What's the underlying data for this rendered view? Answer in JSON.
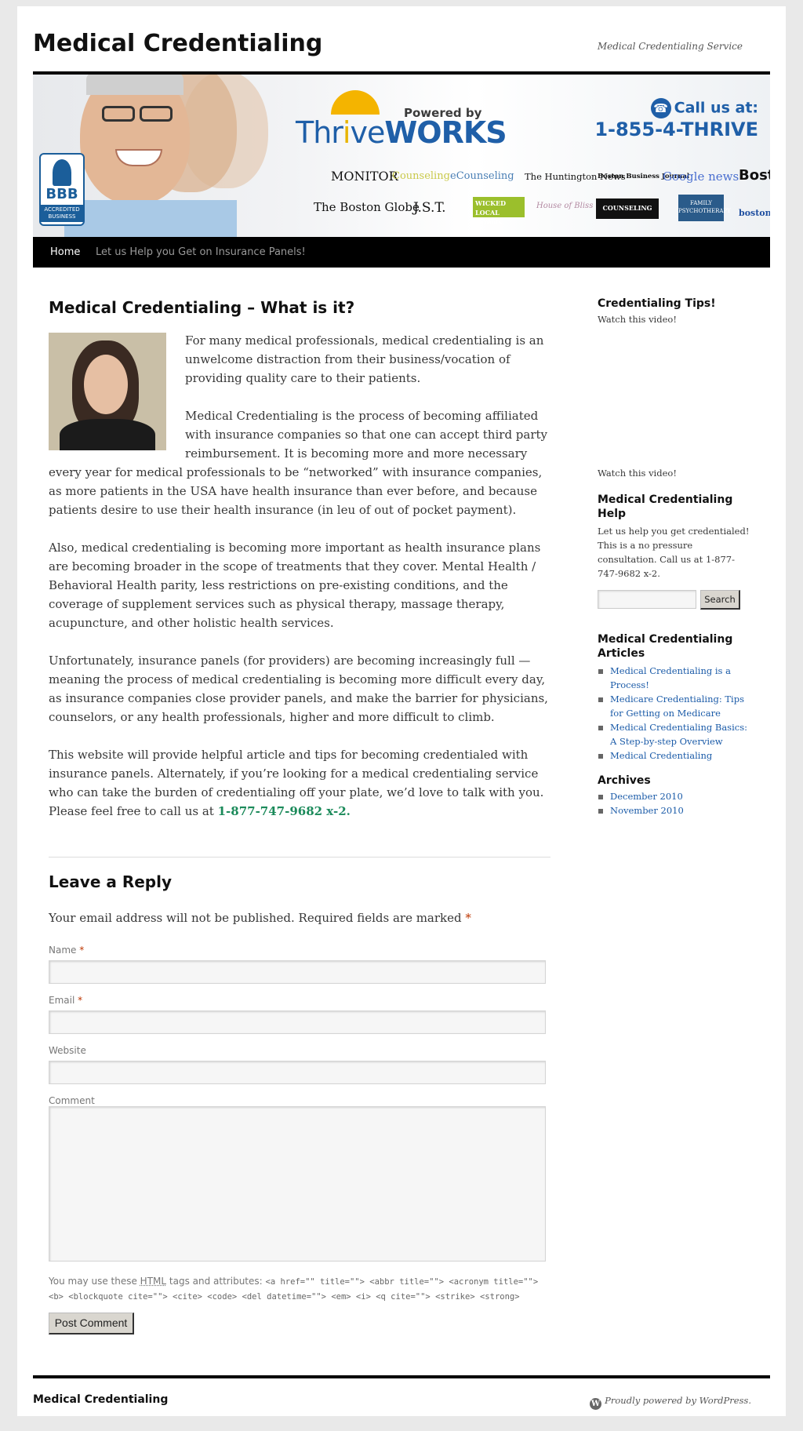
{
  "site": {
    "title": "Medical Credentialing",
    "description": "Medical Credentialing Service"
  },
  "banner": {
    "powered_by": "Powered by",
    "brand_thin": "Thr",
    "brand_i": "i",
    "brand_ve": "ve",
    "brand_bold": "WORKS",
    "call_label": "Call us at:",
    "call_number": "1-855-4-THRIVE",
    "bbb_word": "BBB",
    "bbb_sub": "ACCREDITED BUSINESS",
    "logos": [
      "MONITOR",
      "Counseling",
      "eCounseling",
      "The Huntington News",
      "Boston Business Journal",
      "Google news",
      "Boston",
      "The Boston Globe",
      "J.S.T.",
      "WICKED LOCAL Parents",
      "House of Bliss",
      "COUNSELING",
      "FAMILY PSYCHOTHERAPY",
      "boston.com"
    ]
  },
  "nav": {
    "items": [
      {
        "label": "Home"
      },
      {
        "label": "Let us Help you Get on Insurance Panels!"
      }
    ]
  },
  "post": {
    "title": "Medical Credentialing – What is it?",
    "p1": "For many medical professionals, medical credentialing is an unwelcome distraction from their business/vocation of providing quality care to their patients.",
    "p2": "Medical Credentialing is the process of becoming affiliated with insurance companies so that one can accept third party reimbursement. It is becoming more and more necessary every year for medical professionals to be “networked” with insurance companies, as more patients in the USA have health insurance than ever before, and because patients desire to use their health insurance (in leu of out of pocket payment).",
    "p3": "Also, medical credentialing is becoming more important as health insurance plans are becoming broader in the scope of treatments that they cover. Mental Health / Behavioral Health parity, less restrictions on pre-existing conditions, and the coverage of supplement services such as physical therapy, massage therapy, acupuncture, and other holistic health services.",
    "p4": "Unfortunately, insurance panels (for providers) are becoming increasingly full — meaning the process of medical credentialing is becoming more difficult every day, as insurance companies close provider panels, and make the barrier for physicians, counselors, or any health professionals, higher and more difficult to climb.",
    "p5": "This website will provide helpful article and tips for becoming credentialed with insurance panels. Alternately, if you’re looking for a medical credentialing service who can take the burden of credentialing off your plate, we’d love to talk with you. Please feel free to call us at",
    "phone": "1-877-747-9682 x-2."
  },
  "reply": {
    "title": "Leave a Reply",
    "note": "Your email address will not be published. Required fields are marked",
    "required_mark": "*",
    "name_label": "Name",
    "email_label": "Email",
    "website_label": "Website",
    "comment_label": "Comment",
    "allowed_prefix": "You may use these",
    "allowed_abbr": "HTML",
    "allowed_mid": "tags and attributes:",
    "allowed_code": "<a href=\"\" title=\"\"> <abbr title=\"\"> <acronym title=\"\"> <b> <blockquote cite=\"\"> <cite> <code> <del datetime=\"\"> <em> <i> <q cite=\"\"> <strike> <strong>",
    "submit_label": "Post Comment"
  },
  "sidebar": {
    "tips_title": "Credentialing Tips!",
    "watch1": "Watch this video!",
    "watch2": "Watch this video!",
    "help_title": "Medical Credentialing Help",
    "help_text": "Let us help you get credentialed! This is a no pressure consultation. Call us at 1-877-747-9682 x-2.",
    "search_button": "Search",
    "articles_title": "Medical Credentialing Articles",
    "articles": [
      {
        "label": "Medical Credentialing is a Process!"
      },
      {
        "label": "Medicare Credentialing: Tips for Getting on Medicare"
      },
      {
        "label": "Medical Credentialing Basics: A Step-by-step Overview"
      },
      {
        "label": "Medical Credentialing"
      }
    ],
    "archives_title": "Archives",
    "archives": [
      {
        "label": "December 2010"
      },
      {
        "label": "November 2010"
      }
    ]
  },
  "footer": {
    "title": "Medical Credentialing",
    "powered": "Proudly powered by WordPress."
  },
  "colors": {
    "link": "#1b5ba8",
    "phone": "#1b8a5a",
    "required": "#bd3500",
    "brand_blue": "#1f5fa8"
  }
}
